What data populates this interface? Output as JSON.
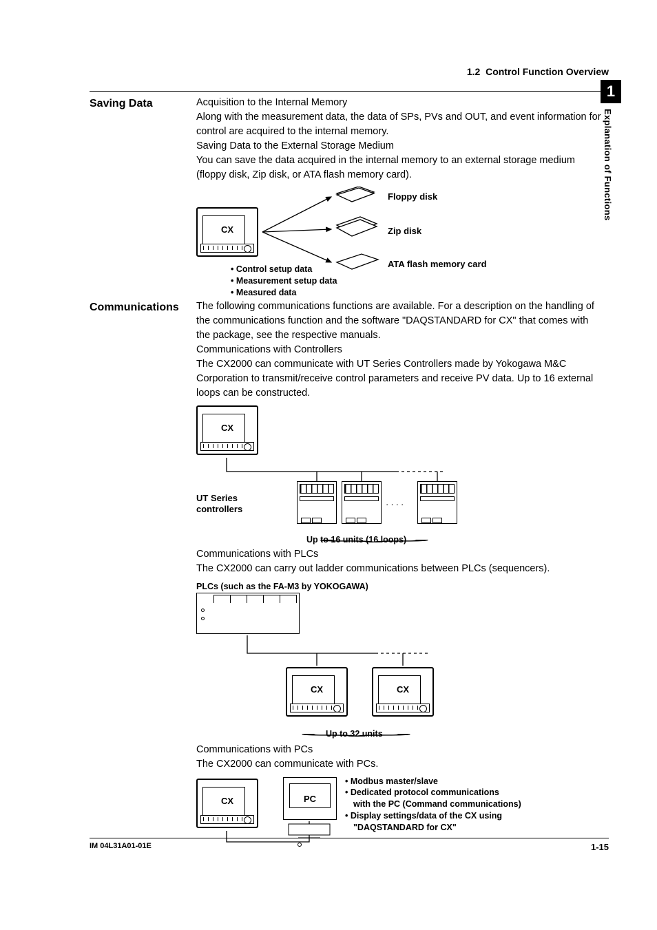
{
  "header": {
    "section_number": "1.2",
    "section_title": "Control Function Overview"
  },
  "side_tab": {
    "chapter_number": "1",
    "chapter_title": "Explanation of Functions"
  },
  "saving_data": {
    "heading": "Saving Data",
    "acq_heading": "Acquisition to the Internal Memory",
    "acq_body": "Along with the measurement data, the data of SPs, PVs and OUT, and event information for control are acquired to the internal memory.",
    "ext_heading": "Saving Data to the External Storage Medium",
    "ext_body": "You can save the data acquired in the internal memory to an external storage medium (floppy disk, Zip disk, or ATA flash memory card).",
    "diagram": {
      "cx_label": "CX",
      "media": {
        "floppy": "Floppy disk",
        "zip": "Zip disk",
        "ata": "ATA flash memory card"
      },
      "bullets": [
        "Control setup data",
        "Measurement setup data",
        "Measured data"
      ]
    }
  },
  "communications": {
    "heading": "Communications",
    "intro": "The following communications functions are available.  For a description on the handling of the communications function and the software \"DAQSTANDARD for CX\" that comes with the package, see the respective manuals.",
    "controllers": {
      "heading": "Communications with Controllers",
      "body": "The CX2000 can communicate with UT Series Controllers made by Yokogawa M&C Corporation to transmit/receive control parameters and receive PV data.  Up to 16 external loops can be constructed.",
      "cx_label": "CX",
      "ut_label_1": "UT Series",
      "ut_label_2": "controllers",
      "caption": "Up to 16 units (16 loops)"
    },
    "plcs": {
      "heading": "Communications with PLCs",
      "body": "The CX2000 can carry out ladder communications between PLCs (sequencers).",
      "plc_caption": "PLCs (such as the FA-M3 by YOKOGAWA)",
      "cx_label": "CX",
      "caption": "Up to 32 units"
    },
    "pcs": {
      "heading": "Communications with PCs",
      "body": "The CX2000 can communicate with PCs.",
      "cx_label": "CX",
      "pc_label": "PC",
      "bullets": [
        "Modbus master/slave",
        "Dedicated protocol communications",
        "with the PC (Command communications)",
        "Display settings/data of the CX using",
        "\"DAQSTANDARD for CX\""
      ]
    }
  },
  "footer": {
    "doc_id": "IM 04L31A01-01E",
    "page_number": "1-15"
  }
}
